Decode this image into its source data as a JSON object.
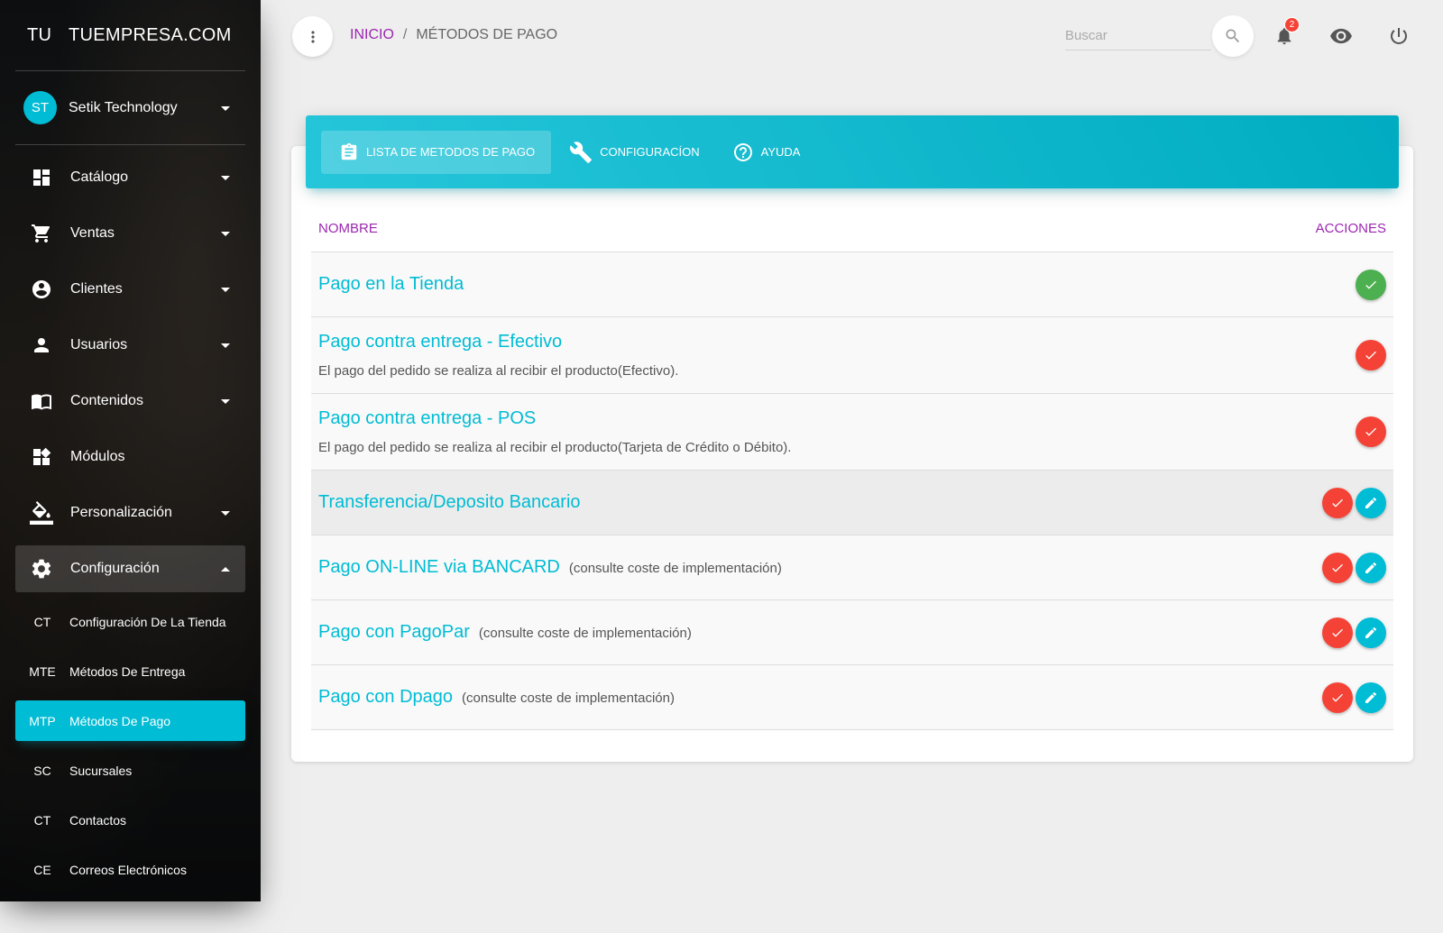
{
  "brand": {
    "mini": "TU",
    "full": "TUEMPRESA.COM"
  },
  "user": {
    "initials": "ST",
    "name": "Setik Technology"
  },
  "sidebar": {
    "items": [
      {
        "label": "Catálogo",
        "icon": "dashboard-icon"
      },
      {
        "label": "Ventas",
        "icon": "cart-icon"
      },
      {
        "label": "Clientes",
        "icon": "account-circle-icon"
      },
      {
        "label": "Usuarios",
        "icon": "person-icon"
      },
      {
        "label": "Contenidos",
        "icon": "book-icon"
      },
      {
        "label": "Módulos",
        "icon": "widgets-icon"
      },
      {
        "label": "Personalización",
        "icon": "paint-bucket-icon"
      },
      {
        "label": "Configuración",
        "icon": "gear-icon"
      }
    ],
    "subitems": [
      {
        "abbr": "CT",
        "label": "Configuración De La Tienda"
      },
      {
        "abbr": "MTE",
        "label": "Métodos De Entrega"
      },
      {
        "abbr": "MTP",
        "label": "Métodos De Pago"
      },
      {
        "abbr": "SC",
        "label": "Sucursales"
      },
      {
        "abbr": "CT",
        "label": "Contactos"
      },
      {
        "abbr": "CE",
        "label": "Correos Electrónicos"
      }
    ]
  },
  "breadcrumb": {
    "home": "INICIO",
    "sep": "/",
    "current": "MÉTODOS DE PAGO"
  },
  "search": {
    "placeholder": "Buscar"
  },
  "notifications": {
    "count": "2"
  },
  "tabs": [
    {
      "label": "LISTA DE METODOS DE PAGO",
      "icon": "clipboard-icon"
    },
    {
      "label": "CONFIGURACÍON",
      "icon": "wrench-icon"
    },
    {
      "label": "AYUDA",
      "icon": "help-icon"
    }
  ],
  "table": {
    "headers": {
      "name": "NOMBRE",
      "actions": "ACCIONES"
    },
    "rows": [
      {
        "title": "Pago en la Tienda",
        "note": "",
        "desc": "",
        "status": "green",
        "editable": false
      },
      {
        "title": "Pago contra entrega - Efectivo",
        "note": "",
        "desc": "El pago del pedido se realiza al recibir el producto(Efectivo).",
        "status": "red",
        "editable": false
      },
      {
        "title": "Pago contra entrega - POS",
        "note": "",
        "desc": "El pago del pedido se realiza al recibir el producto(Tarjeta de Crédito o Débito).",
        "status": "red",
        "editable": false
      },
      {
        "title": "Transferencia/Deposito Bancario",
        "note": "",
        "desc": "",
        "status": "red",
        "editable": true
      },
      {
        "title": "Pago ON-LINE via BANCARD",
        "note": "(consulte coste de implementación)",
        "desc": "",
        "status": "red",
        "editable": true
      },
      {
        "title": "Pago con PagoPar",
        "note": "(consulte coste de implementación)",
        "desc": "",
        "status": "red",
        "editable": true
      },
      {
        "title": "Pago con Dpago",
        "note": "(consulte coste de implementación)",
        "desc": "",
        "status": "red",
        "editable": true
      }
    ]
  },
  "colors": {
    "accent": "#00bcd4",
    "purple": "#9c27b0",
    "green": "#4caf50",
    "red": "#f44336"
  }
}
